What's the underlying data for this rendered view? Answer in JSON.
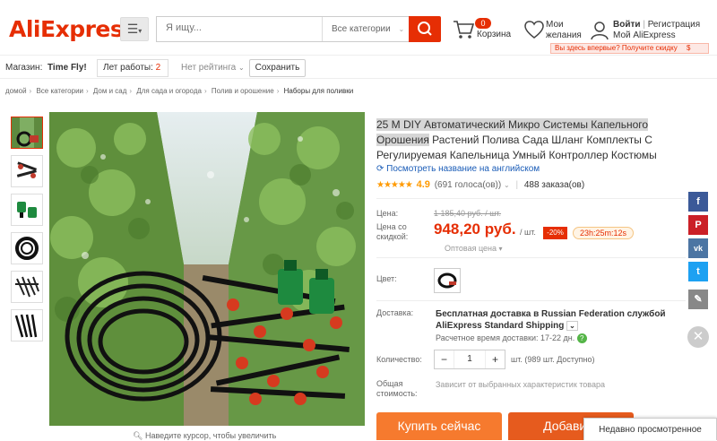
{
  "header": {
    "logo": "AliExpress",
    "search_placeholder": "Я ищу...",
    "search_category": "Все категории",
    "cart_count": "0",
    "cart_label": "Корзина",
    "wishlist_line1": "Мои",
    "wishlist_line2": "желания",
    "login": "Войти",
    "login_sep": "|",
    "register": "Регистрация",
    "my_account": "Мой AliExpress",
    "promo": "Вы здесь впервые? Получите скидку",
    "promo_dollar": "$"
  },
  "store": {
    "label": "Магазин:",
    "name": "Time Fly!",
    "years_label": "Лет работы:",
    "years_value": "2",
    "rating": "Нет рейтинга",
    "save": "Сохранить"
  },
  "breadcrumb": [
    "домой",
    "Все категории",
    "Дом и сад",
    "Для сада и огорода",
    "Полив и орошение",
    "Наборы для поливки"
  ],
  "gallery": {
    "hint": "Наведите курсор, чтобы увеличить"
  },
  "product": {
    "title_highlight": "25 M DIY Автоматический Микро Системы Капельного Орошения",
    "title_rest": " Растений Полива Сада Шланг Комплекты С Регулируемая Капельница Умный Контроллер Костюмы",
    "translate": "Посмотреть название на английском",
    "stars": "★★★★★",
    "score": "4.9",
    "votes": "(691 голоса(ов))",
    "orders": "488 заказа(ов)",
    "price_label": "Цена:",
    "old_price": "1 185,40 руб. / шт.",
    "discount_price_label_1": "Цена со",
    "discount_price_label_2": "скидкой:",
    "price": "948,20 руб.",
    "per_unit": "/ шт.",
    "discount": "-20%",
    "timer": "23h:25m:12s",
    "wholesale": "Оптовая цена",
    "color_label": "Цвет:",
    "delivery_label": "Доставка:",
    "shipping": "Бесплатная доставка в Russian Federation службой AliExpress Standard Shipping",
    "delivery_time": "Расчетное время доставки: 17-22 дн.",
    "qty_label": "Количество:",
    "qty_value": "1",
    "qty_minus": "−",
    "qty_plus": "+",
    "available": "шт. (989 шт. Доступно)",
    "total_label_1": "Общая",
    "total_label_2": "стоимость:",
    "total_value": "Зависит от выбранных характеристик товара",
    "buy": "Купить сейчас",
    "add_to_cart": "Добавить"
  },
  "recently_viewed": "Недавно просмотренное",
  "social": [
    "f",
    "P",
    "vk",
    "t",
    "✎"
  ],
  "colors": {
    "accent": "#e62e04",
    "star": "#ff9a00",
    "buy_button": "#f67a2e",
    "cart_button": "#e65b1e",
    "link": "#1a5cb7"
  }
}
